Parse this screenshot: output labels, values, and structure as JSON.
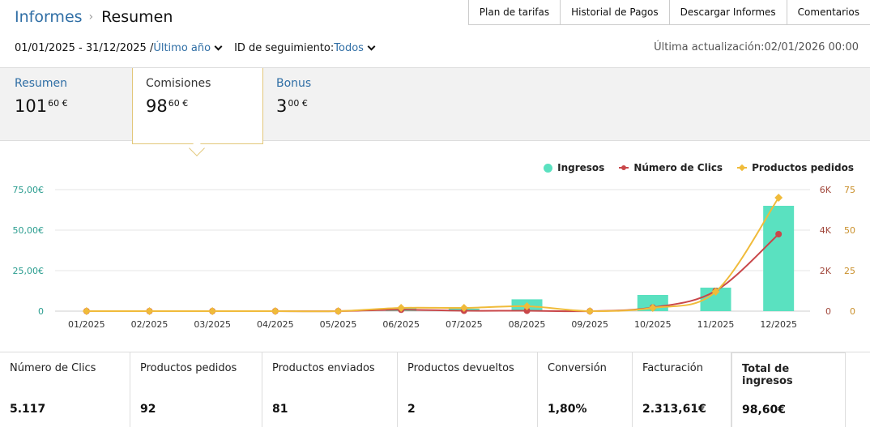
{
  "header": {
    "breadcrumb_root": "Informes",
    "breadcrumb_current": "Resumen",
    "top_tabs": [
      "Plan de tarifas",
      "Historial de Pagos",
      "Descargar Informes",
      "Comentarios"
    ]
  },
  "filters": {
    "date_range": "01/01/2025 - 31/12/2025 /",
    "period": "Último año",
    "tracking_label": "ID de seguimiento:",
    "tracking_value": "Todos",
    "last_updated": "Última actualización:02/01/2026 00:00"
  },
  "summary_tabs": [
    {
      "label": "Resumen",
      "int": "101",
      "dec": "60 €"
    },
    {
      "label": "Comisiones",
      "int": "98",
      "dec": "60 €"
    },
    {
      "label": "Bonus",
      "int": "3",
      "dec": "00 €"
    }
  ],
  "legend": {
    "ingresos": "Ingresos",
    "clics": "Número de Clics",
    "productos": "Productos pedidos"
  },
  "colors": {
    "ingresos": "#5ae1c0",
    "clics": "#c9474a",
    "productos": "#f0bb3a",
    "axis_left": "#2a9d8f",
    "axis_mid": "#a0463a",
    "axis_right": "#c98f2a"
  },
  "chart_data": {
    "type": "bar",
    "categories": [
      "01/2025",
      "02/2025",
      "03/2025",
      "04/2025",
      "05/2025",
      "06/2025",
      "07/2025",
      "08/2025",
      "09/2025",
      "10/2025",
      "11/2025",
      "12/2025"
    ],
    "series": [
      {
        "name": "Ingresos",
        "type": "bar",
        "axis": "left",
        "values": [
          0,
          0,
          0,
          0,
          0,
          1.8,
          1.5,
          7.3,
          0,
          10.0,
          14.5,
          65.0
        ]
      },
      {
        "name": "Número de Clics",
        "type": "line",
        "axis": "middle",
        "values": [
          0,
          0,
          0,
          0,
          0,
          70,
          20,
          20,
          0,
          180,
          1000,
          3800
        ]
      },
      {
        "name": "Productos pedidos",
        "type": "line",
        "axis": "right",
        "values": [
          0,
          0,
          0,
          0,
          0,
          2,
          2,
          3,
          0,
          2,
          12,
          70
        ]
      }
    ],
    "axes": {
      "left": {
        "ylim": [
          0,
          75
        ],
        "ticks": [
          "0",
          "25,00€",
          "50,00€",
          "75,00€"
        ]
      },
      "middle": {
        "ylim": [
          0,
          6000
        ],
        "ticks": [
          "0",
          "2K",
          "4K",
          "6K"
        ]
      },
      "right": {
        "ylim": [
          0,
          75
        ],
        "ticks": [
          "0",
          "25",
          "50",
          "75"
        ]
      }
    },
    "grid": true,
    "legend_position": "top-right"
  },
  "stats": [
    {
      "label": "Número de Clics",
      "value": "5.117"
    },
    {
      "label": "Productos pedidos",
      "value": "92"
    },
    {
      "label": "Productos enviados",
      "value": "81"
    },
    {
      "label": "Productos devueltos",
      "value": "2"
    },
    {
      "label": "Conversión",
      "value": "1,80%"
    },
    {
      "label": "Facturación",
      "value": "2.313,61€"
    },
    {
      "label": "Total de ingresos",
      "value": "98,60€"
    }
  ]
}
